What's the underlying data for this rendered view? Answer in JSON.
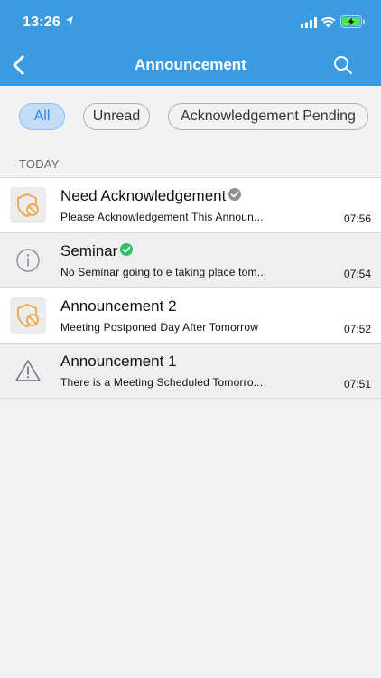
{
  "status_bar": {
    "time": "13:26"
  },
  "header": {
    "title": "Announcement"
  },
  "filters": [
    {
      "label": "All",
      "active": true
    },
    {
      "label": "Unread",
      "active": false
    },
    {
      "label": "Acknowledgement Pending",
      "active": false
    }
  ],
  "section_label": "TODAY",
  "items": [
    {
      "title": "Need Acknowledgement",
      "body": "Please Acknowledgement This Announ...",
      "time": "07:56",
      "icon": "shield-blocked-icon",
      "badge": "grey-check-badge",
      "read": false
    },
    {
      "title": "Seminar",
      "body": "No Seminar going to e taking place tom...",
      "time": "07:54",
      "icon": "info-circle-icon",
      "badge": "green-check-badge",
      "read": true
    },
    {
      "title": "Announcement 2",
      "body": "Meeting Postponed Day After Tomorrow",
      "time": "07:52",
      "icon": "shield-blocked-icon",
      "badge": "",
      "read": false
    },
    {
      "title": "Announcement 1",
      "body": "There is a Meeting Scheduled Tomorro...",
      "time": "07:51",
      "icon": "warning-triangle-icon",
      "badge": "",
      "read": true
    }
  ],
  "colors": {
    "header": "#3a9be2",
    "accent": "#2f87dc",
    "warning_icon": "#f0a446",
    "verified_green": "#2cc26a"
  }
}
